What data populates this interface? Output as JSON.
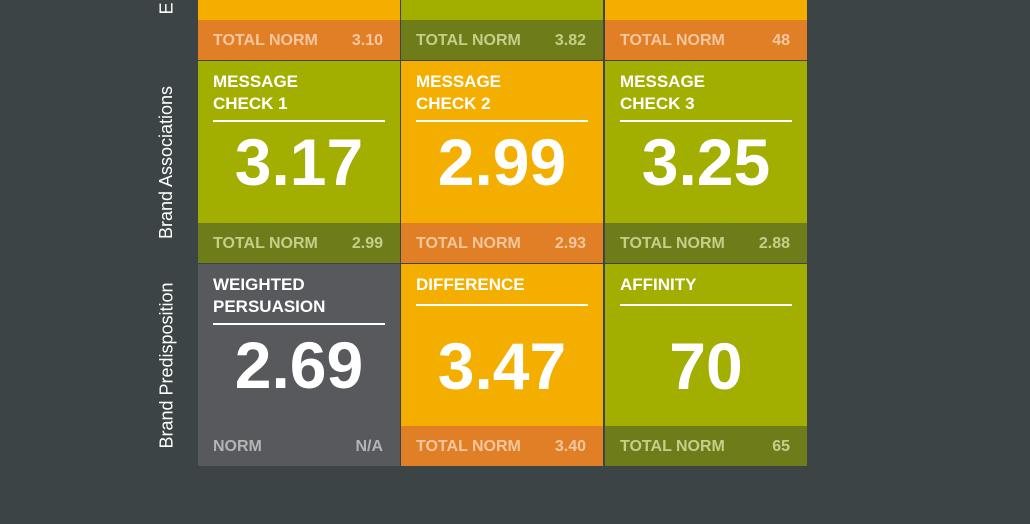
{
  "rows": [
    {
      "label": "E"
    },
    {
      "label": "Brand Associations"
    },
    {
      "label": "Brand Predisposition"
    }
  ],
  "top_row": [
    {
      "norm_label": "TOTAL NORM",
      "norm_value": "3.10"
    },
    {
      "norm_label": "TOTAL NORM",
      "norm_value": "3.82"
    },
    {
      "norm_label": "TOTAL NORM",
      "norm_value": "48"
    }
  ],
  "brand_associations": [
    {
      "title_1": "MESSAGE",
      "title_2": "CHECK 1",
      "value": "3.17",
      "norm_label": "TOTAL NORM",
      "norm_value": "2.99"
    },
    {
      "title_1": "MESSAGE",
      "title_2": "CHECK 2",
      "value": "2.99",
      "norm_label": "TOTAL NORM",
      "norm_value": "2.93"
    },
    {
      "title_1": "MESSAGE",
      "title_2": "CHECK 3",
      "value": "3.25",
      "norm_label": "TOTAL NORM",
      "norm_value": "2.88"
    }
  ],
  "brand_predisposition": [
    {
      "title_1": "WEIGHTED",
      "title_2": "PERSUASION",
      "value": "2.69",
      "norm_label": "NORM",
      "norm_value": "N/A"
    },
    {
      "title_1": "DIFFERENCE",
      "title_2": "",
      "value": "3.47",
      "norm_label": "TOTAL NORM",
      "norm_value": "3.40"
    },
    {
      "title_1": "AFFINITY",
      "title_2": "",
      "value": "70",
      "norm_label": "TOTAL NORM",
      "norm_value": "65"
    }
  ],
  "colors": {
    "background": "#3c4446",
    "green": "#a2ae00",
    "green_dark": "#6e7d1a",
    "orange": "#f4ae00",
    "orange_dark": "#e07f26",
    "gray": "#58595c"
  }
}
